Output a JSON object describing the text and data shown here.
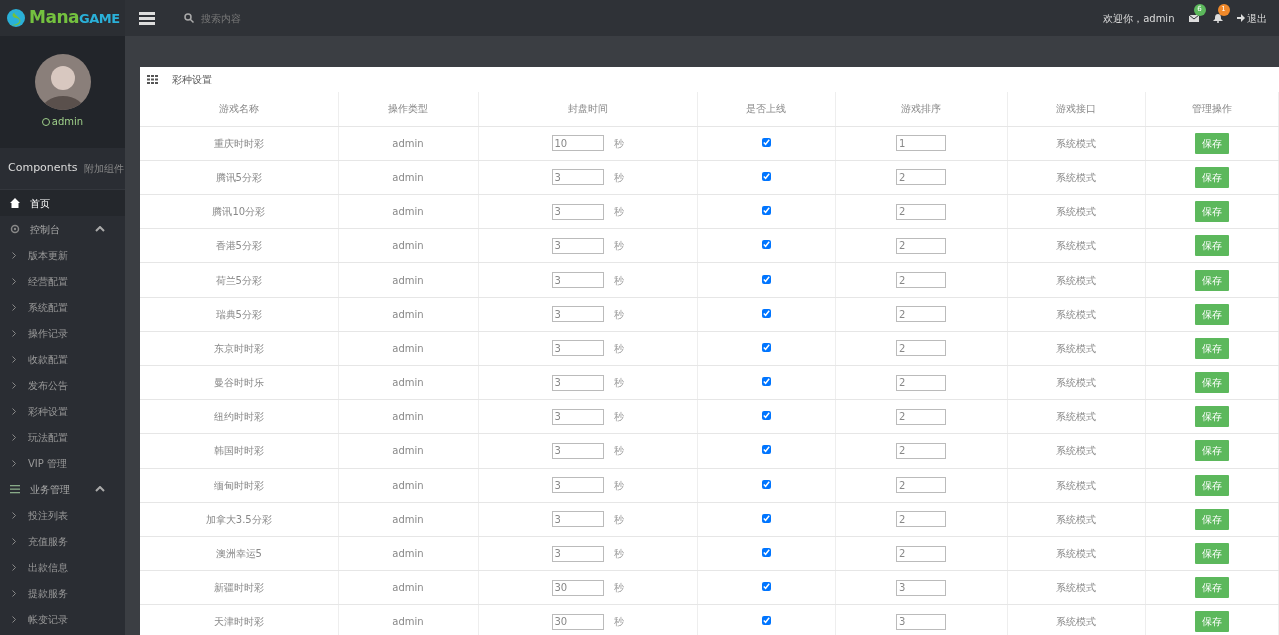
{
  "brand": {
    "part1": "Mana",
    "part2": "GAME"
  },
  "search": {
    "placeholder": "搜索内容"
  },
  "header": {
    "welcome": "欢迎你，admin",
    "mail_count": "6",
    "bell_count": "1",
    "logout": "退出"
  },
  "user": {
    "name": "admin",
    "online": true
  },
  "sidebar": {
    "title": "Components",
    "subtitle": "附加组件",
    "items": [
      {
        "label": "首页",
        "selected": true
      },
      {
        "label": "控制台",
        "selected": false,
        "expanded": true,
        "children": [
          {
            "label": "版本更新"
          },
          {
            "label": "经营配置"
          },
          {
            "label": "系统配置"
          },
          {
            "label": "操作记录"
          },
          {
            "label": "收款配置"
          },
          {
            "label": "发布公告"
          },
          {
            "label": "彩种设置"
          },
          {
            "label": "玩法配置"
          },
          {
            "label": "VIP 管理"
          }
        ]
      },
      {
        "label": "业务管理",
        "selected": false,
        "expanded": true,
        "children": [
          {
            "label": "投注列表"
          },
          {
            "label": "充值服务"
          },
          {
            "label": "出款信息"
          },
          {
            "label": "提款服务"
          },
          {
            "label": "帐变记录"
          }
        ]
      }
    ]
  },
  "panel": {
    "title": "彩种设置"
  },
  "table": {
    "columns": [
      "游戏名称",
      "操作类型",
      "封盘时间",
      "是否上线",
      "游戏排序",
      "游戏接口",
      "管理操作"
    ],
    "rows": [
      {
        "name": "重庆时时彩",
        "type": "admin",
        "close_time": "10",
        "unit": "秒",
        "online": true,
        "order": "1",
        "interface": "系统模式",
        "action": "保存"
      },
      {
        "name": "腾讯5分彩",
        "type": "admin",
        "close_time": "3",
        "unit": "秒",
        "online": true,
        "order": "2",
        "interface": "系统模式",
        "action": "保存"
      },
      {
        "name": "腾讯10分彩",
        "type": "admin",
        "close_time": "3",
        "unit": "秒",
        "online": true,
        "order": "2",
        "interface": "系统模式",
        "action": "保存"
      },
      {
        "name": "香港5分彩",
        "type": "admin",
        "close_time": "3",
        "unit": "秒",
        "online": true,
        "order": "2",
        "interface": "系统模式",
        "action": "保存"
      },
      {
        "name": "荷兰5分彩",
        "type": "admin",
        "close_time": "3",
        "unit": "秒",
        "online": true,
        "order": "2",
        "interface": "系统模式",
        "action": "保存"
      },
      {
        "name": "瑞典5分彩",
        "type": "admin",
        "close_time": "3",
        "unit": "秒",
        "online": true,
        "order": "2",
        "interface": "系统模式",
        "action": "保存"
      },
      {
        "name": "东京时时彩",
        "type": "admin",
        "close_time": "3",
        "unit": "秒",
        "online": true,
        "order": "2",
        "interface": "系统模式",
        "action": "保存"
      },
      {
        "name": "曼谷时时乐",
        "type": "admin",
        "close_time": "3",
        "unit": "秒",
        "online": true,
        "order": "2",
        "interface": "系统模式",
        "action": "保存"
      },
      {
        "name": "纽约时时彩",
        "type": "admin",
        "close_time": "3",
        "unit": "秒",
        "online": true,
        "order": "2",
        "interface": "系统模式",
        "action": "保存"
      },
      {
        "name": "韩国时时彩",
        "type": "admin",
        "close_time": "3",
        "unit": "秒",
        "online": true,
        "order": "2",
        "interface": "系统模式",
        "action": "保存"
      },
      {
        "name": "缅甸时时彩",
        "type": "admin",
        "close_time": "3",
        "unit": "秒",
        "online": true,
        "order": "2",
        "interface": "系统模式",
        "action": "保存"
      },
      {
        "name": "加拿大3.5分彩",
        "type": "admin",
        "close_time": "3",
        "unit": "秒",
        "online": true,
        "order": "2",
        "interface": "系统模式",
        "action": "保存"
      },
      {
        "name": "澳洲幸运5",
        "type": "admin",
        "close_time": "3",
        "unit": "秒",
        "online": true,
        "order": "2",
        "interface": "系统模式",
        "action": "保存"
      },
      {
        "name": "新疆时时彩",
        "type": "admin",
        "close_time": "30",
        "unit": "秒",
        "online": true,
        "order": "3",
        "interface": "系统模式",
        "action": "保存"
      },
      {
        "name": "天津时时彩",
        "type": "admin",
        "close_time": "30",
        "unit": "秒",
        "online": true,
        "order": "3",
        "interface": "系统模式",
        "action": "保存"
      }
    ]
  }
}
